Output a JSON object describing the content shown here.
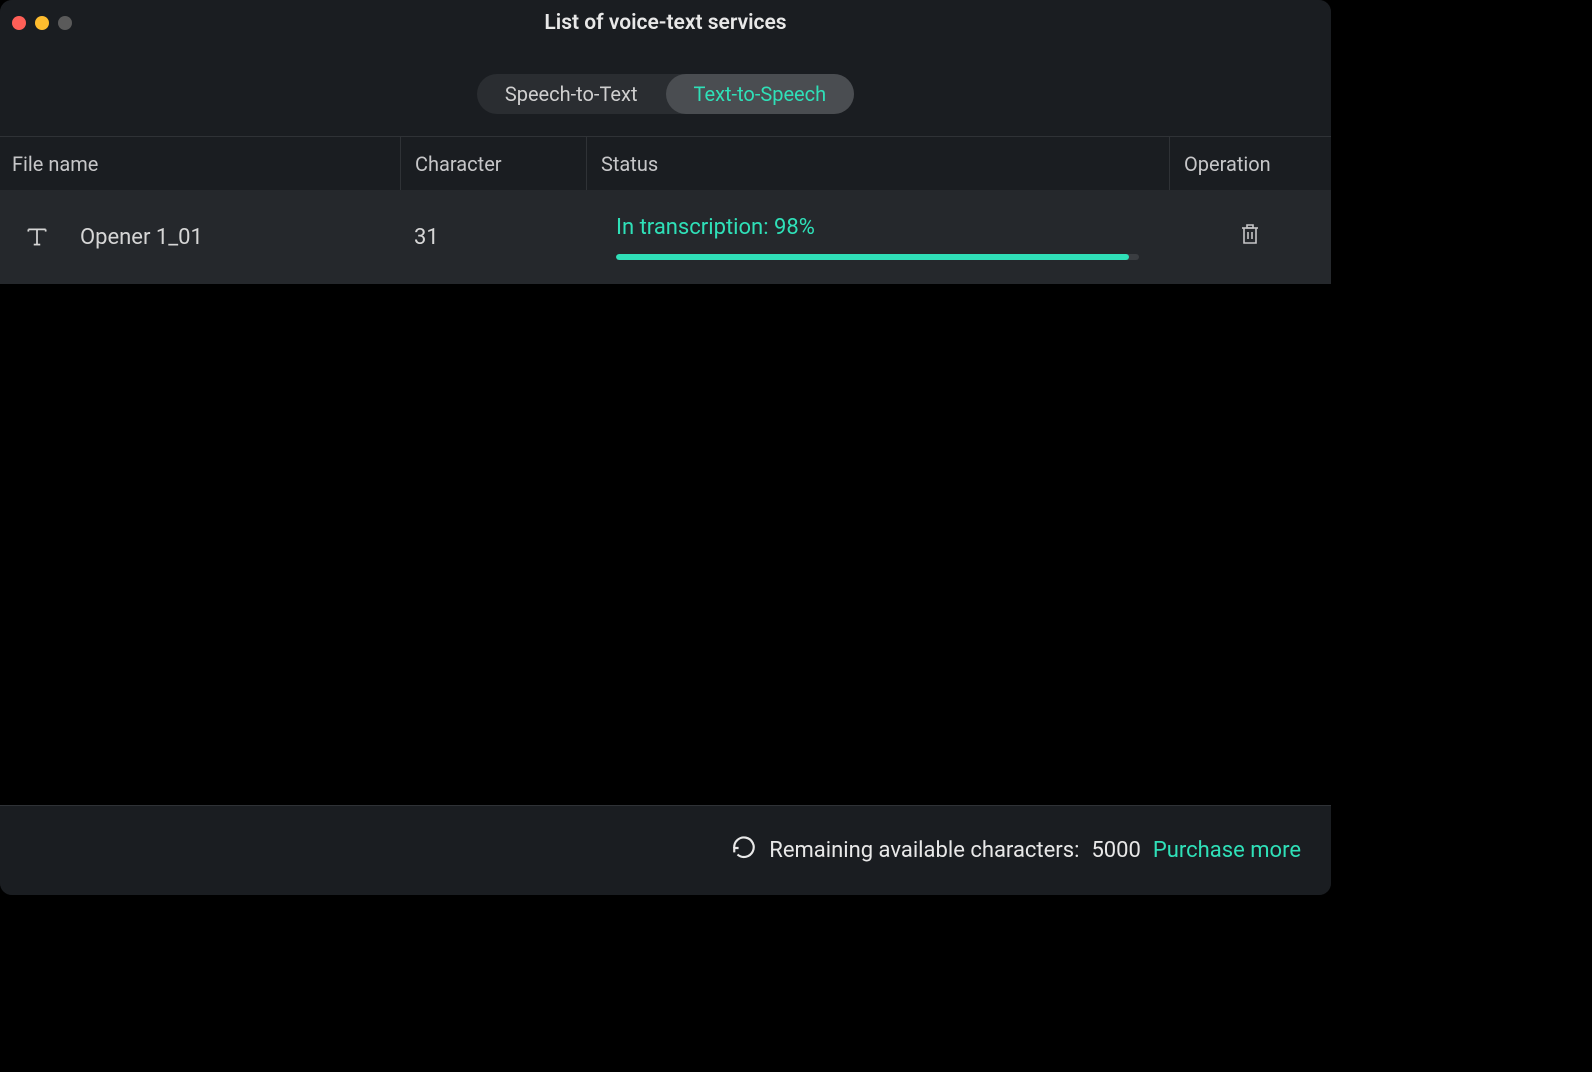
{
  "window": {
    "title": "List of voice-text services"
  },
  "tabs": {
    "stt": "Speech-to-Text",
    "tts": "Text-to-Speech"
  },
  "columns": {
    "file": "File name",
    "char": "Character",
    "status": "Status",
    "op": "Operation"
  },
  "rows": [
    {
      "file_name": "Opener 1_01",
      "character": "31",
      "status_text": "In transcription: 98%",
      "progress_pct": "98"
    }
  ],
  "footer": {
    "label": "Remaining available characters:",
    "count": "5000",
    "purchase": "Purchase more"
  }
}
